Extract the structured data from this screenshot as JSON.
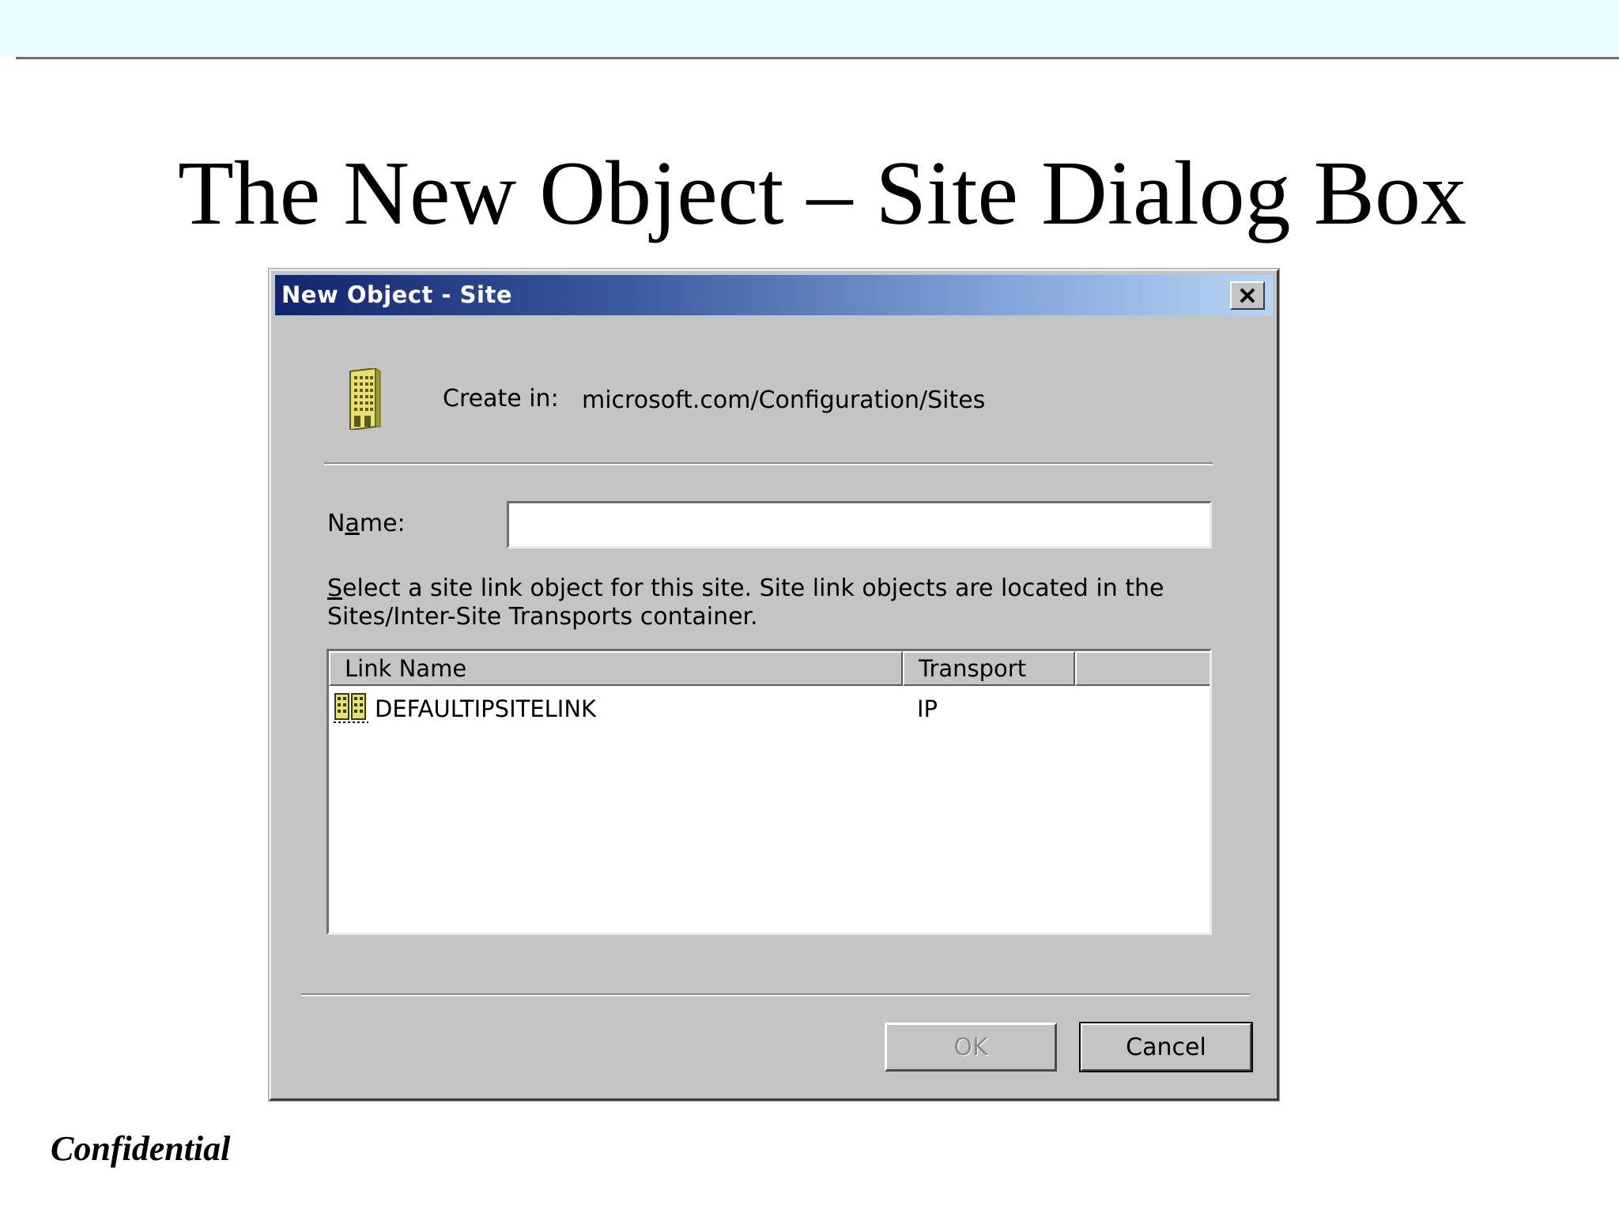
{
  "slide": {
    "title": "The New Object – Site Dialog Box",
    "footer": "Confidential"
  },
  "dialog": {
    "title": "New Object - Site",
    "close_icon": "close-x-icon",
    "create_in_label": "Create in:",
    "create_in_path": "microsoft.com/Configuration/Sites",
    "site_icon": "building-icon",
    "name_label_pre": "N",
    "name_label_mnemonic": "a",
    "name_label_post": "me:",
    "name_value": "",
    "instruction_mnemonic": "S",
    "instruction_line1_rest": "elect a site link object for this site. Site link objects are located in the",
    "instruction_line2": "Sites/Inter-Site Transports container.",
    "list": {
      "columns": [
        "Link Name",
        "Transport"
      ],
      "rows": [
        {
          "icon": "site-link-icon",
          "name": "DEFAULTIPSITELINK",
          "transport": "IP"
        }
      ]
    },
    "buttons": {
      "ok": "OK",
      "cancel": "Cancel"
    }
  }
}
